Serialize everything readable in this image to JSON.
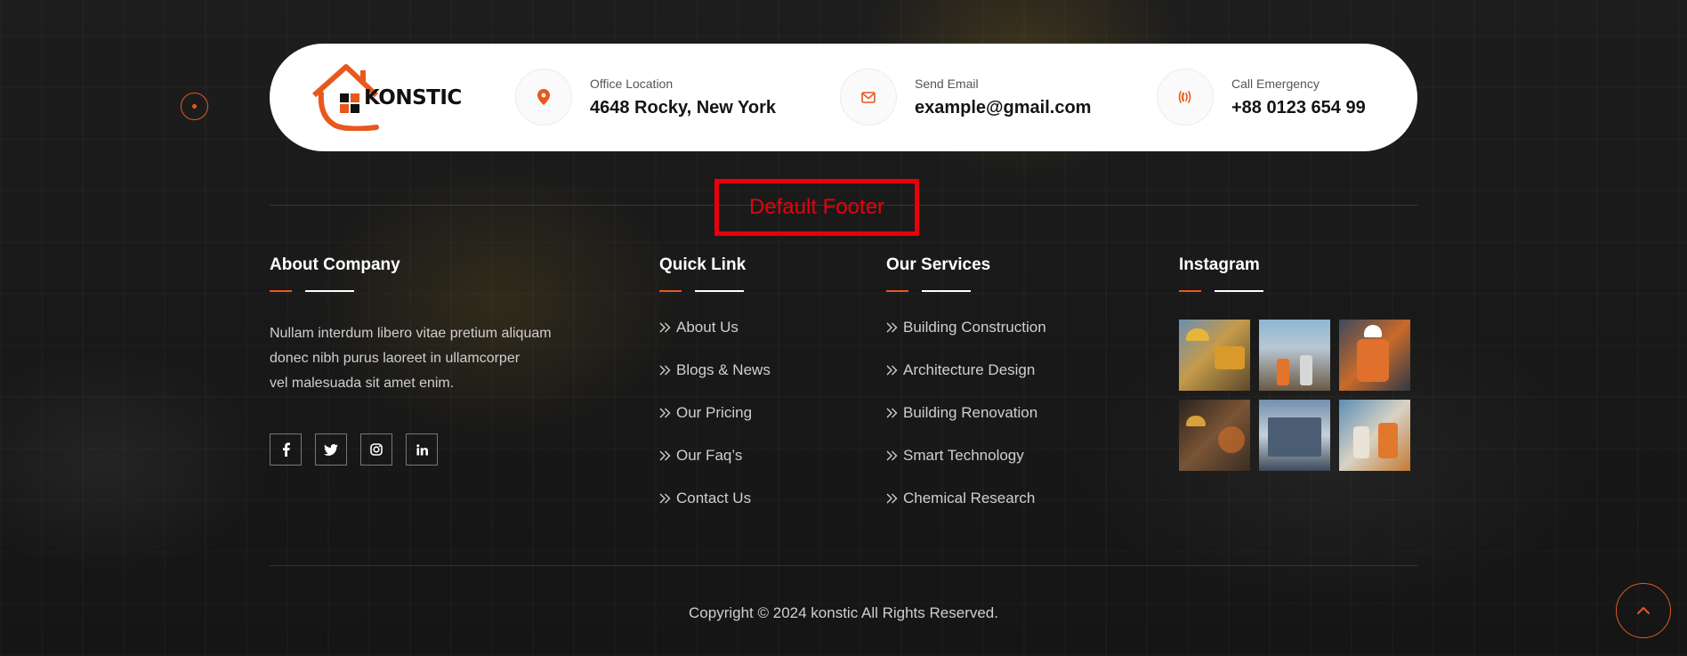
{
  "brand": {
    "name": "KONSTIC",
    "accent": "#e8581d"
  },
  "contact": [
    {
      "label": "Office Location",
      "value": "4648 Rocky, New York",
      "icon": "map-pin-icon"
    },
    {
      "label": "Send Email",
      "value": "example@gmail.com",
      "icon": "envelope-icon"
    },
    {
      "label": "Call Emergency",
      "value": "+88 0123 654 99",
      "icon": "phone-icon"
    }
  ],
  "annotation": "Default Footer",
  "about": {
    "title": "About Company",
    "lines": [
      "Nullam interdum libero vitae pretium aliquam",
      "donec nibh purus laoreet in ullamcorper",
      "vel malesuada sit amet enim."
    ],
    "social": [
      "facebook-icon",
      "twitter-icon",
      "instagram-icon",
      "linkedin-icon"
    ]
  },
  "quick_links": {
    "title": "Quick Link",
    "items": [
      "About Us",
      "Blogs & News",
      "Our Pricing",
      "Our Faq’s",
      "Contact Us"
    ]
  },
  "services": {
    "title": "Our Services",
    "items": [
      "Building Construction",
      "Architecture Design",
      "Building Renovation",
      "Smart Technology",
      "Chemical Research"
    ]
  },
  "instagram": {
    "title": "Instagram",
    "photos": 6
  },
  "copyright": "Copyright © 2024 konstic All Rights Reserved."
}
